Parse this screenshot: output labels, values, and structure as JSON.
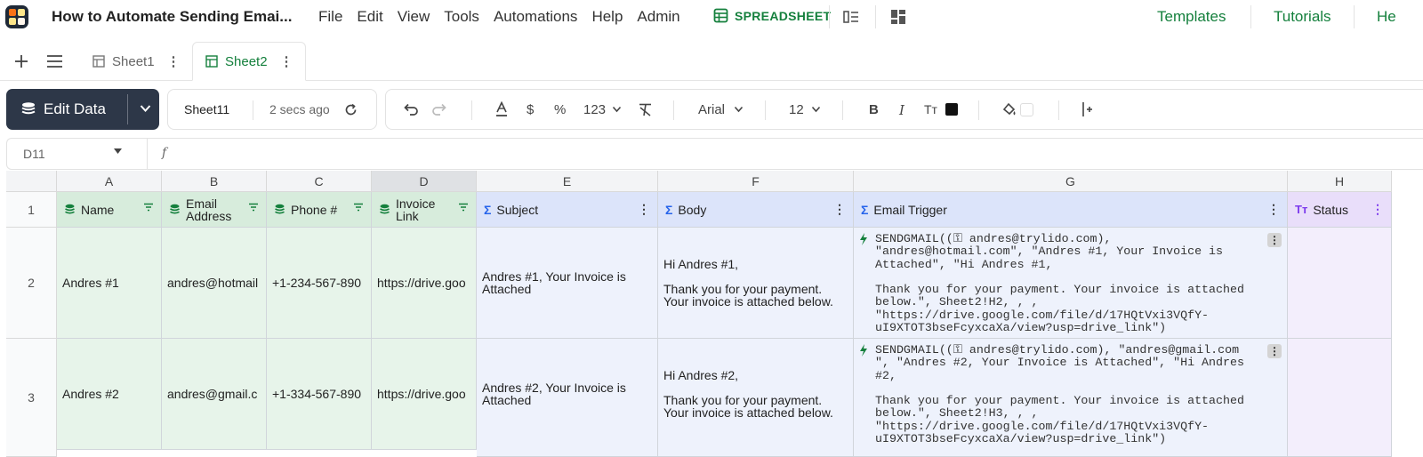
{
  "app": {
    "doc_title": "How to Automate Sending Emai...",
    "menu": [
      "File",
      "Edit",
      "View",
      "Tools",
      "Automations",
      "Help",
      "Admin"
    ],
    "spreadsheet_label": "SPREADSHEET",
    "right_links": [
      "Templates",
      "Tutorials",
      "He"
    ]
  },
  "tabs": [
    {
      "label": "Sheet1",
      "active": false
    },
    {
      "label": "Sheet2",
      "active": true
    }
  ],
  "toolbar": {
    "edit_label": "Edit Data",
    "sheet_name": "Sheet11",
    "saved": "2 secs ago",
    "number_format": "123",
    "font": "Arial",
    "font_size": "12",
    "bold": "B",
    "italic": "I",
    "text_size": "Tт",
    "currency": "$",
    "percent": "%"
  },
  "formula_bar": {
    "cell_ref": "D11",
    "fx": "f",
    "value": ""
  },
  "columns": [
    "A",
    "B",
    "C",
    "D",
    "E",
    "F",
    "G",
    "H"
  ],
  "headers": [
    {
      "label": "Name"
    },
    {
      "label": "Email Address"
    },
    {
      "label": "Phone #"
    },
    {
      "label": "Invoice Link"
    },
    {
      "label": "Subject"
    },
    {
      "label": "Body"
    },
    {
      "label": "Email Trigger"
    },
    {
      "label": "Status"
    }
  ],
  "rows": [
    {
      "num": "2",
      "name": "Andres #1",
      "email": "andres@hotmail",
      "phone": "+1-234-567-890",
      "link": "https://drive.goo",
      "subject": "Andres #1, Your Invoice is Attached",
      "body_1": "Hi Andres #1,",
      "body_2": "Thank you for your payment. Your invoice is attached below.",
      "trigger": "SENDGMAIL((⚿ andres@trylido.com),\n\"andres@hotmail.com\", \"Andres #1, Your Invoice is\nAttached\", \"Hi Andres #1,\n\nThank you for your payment. Your invoice is attached\nbelow.\", Sheet2!H2, , ,\n\"https://drive.google.com/file/d/17HQtVxi3VQfY-\nuI9XTOT3bseFcyxcaXa/view?usp=drive_link\")",
      "status": ""
    },
    {
      "num": "3",
      "name": "Andres #2",
      "email": "andres@gmail.c",
      "phone": "+1-334-567-890",
      "link": "https://drive.goo",
      "subject": "Andres #2, Your Invoice is Attached",
      "body_1": "Hi Andres #2,",
      "body_2": "Thank you for your payment. Your invoice is attached below.",
      "trigger": "SENDGMAIL((⚿ andres@trylido.com), \"andres@gmail.com\n\", \"Andres #2, Your Invoice is Attached\", \"Hi Andres\n#2,\n\nThank you for your payment. Your invoice is attached\nbelow.\", Sheet2!H3, , ,\n\"https://drive.google.com/file/d/17HQtVxi3VQfY-\nuI9XTOT3bseFcyxcaXa/view?usp=drive_link\")",
      "status": ""
    }
  ],
  "row1_num": "1",
  "colors": {
    "accent": "#15803d",
    "dark_button": "#2d3748",
    "green_col": "#d7ecdc",
    "blue_col": "#dce4fa",
    "purple_col": "#e9defa"
  }
}
